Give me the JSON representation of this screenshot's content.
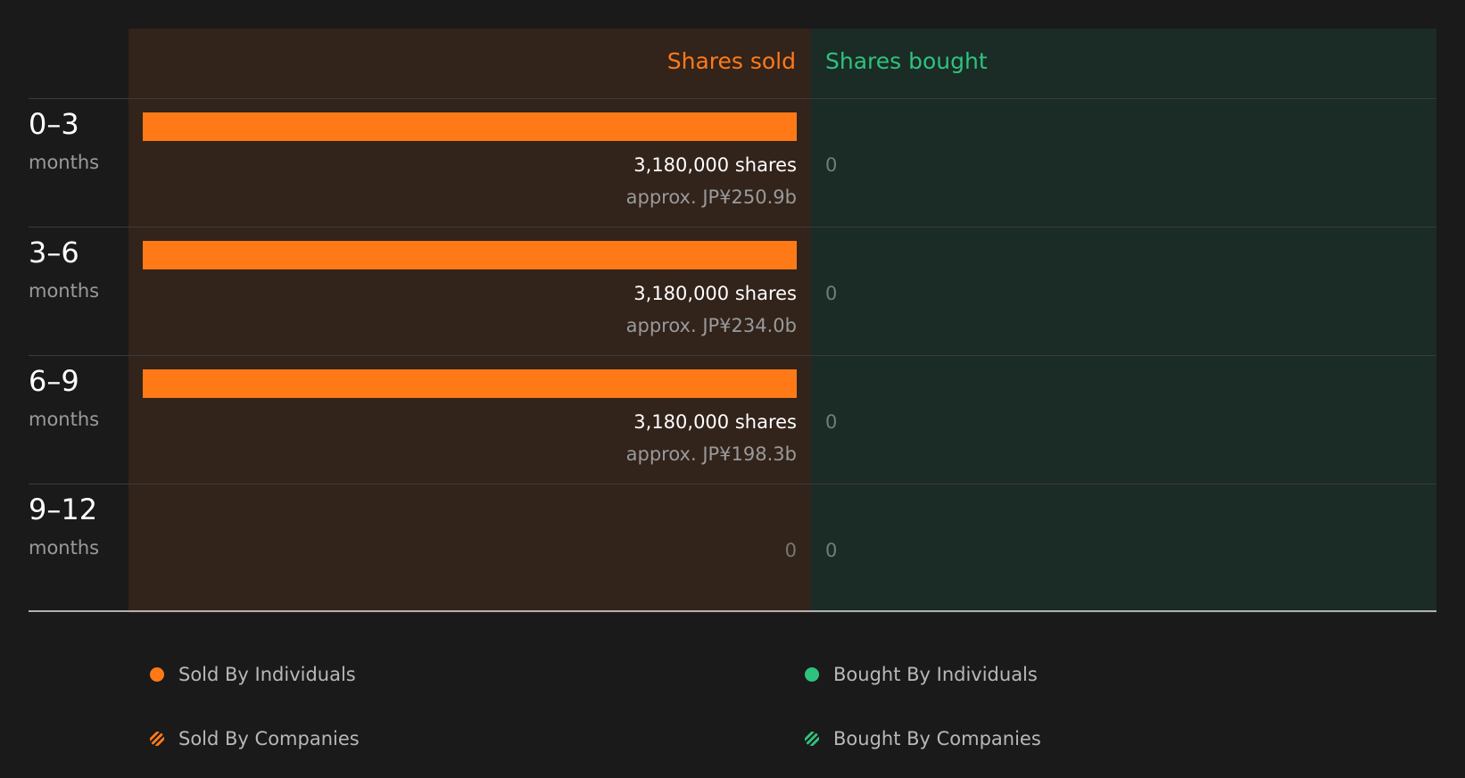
{
  "chart_data": {
    "type": "bar",
    "headers": {
      "sold": "Shares sold",
      "bought": "Shares bought"
    },
    "categories": [
      "0–3",
      "3–6",
      "6–9",
      "9–12"
    ],
    "category_unit": "months",
    "series": [
      {
        "name": "Shares sold",
        "values": [
          3180000,
          3180000,
          3180000,
          0
        ]
      },
      {
        "name": "Shares bought",
        "values": [
          0,
          0,
          0,
          0
        ]
      }
    ],
    "rows": [
      {
        "range": "0–3",
        "unit": "months",
        "sold": 3180000,
        "sold_label": "3,180,000 shares",
        "approx": "approx. JP¥250.9b",
        "bought_label": "0"
      },
      {
        "range": "3–6",
        "unit": "months",
        "sold": 3180000,
        "sold_label": "3,180,000 shares",
        "approx": "approx. JP¥234.0b",
        "bought_label": "0"
      },
      {
        "range": "6–9",
        "unit": "months",
        "sold": 3180000,
        "sold_label": "3,180,000 shares",
        "approx": "approx. JP¥198.3b",
        "bought_label": "0"
      },
      {
        "range": "9–12",
        "unit": "months",
        "sold": 0,
        "sold_label": "0",
        "approx": "",
        "bought_label": "0"
      }
    ],
    "max_value": 3180000,
    "legend": [
      {
        "label": "Sold By Individuals",
        "color": "#ff7a17",
        "style": "solid"
      },
      {
        "label": "Bought By Individuals",
        "color": "#2ec27e",
        "style": "solid"
      },
      {
        "label": "Sold By Companies",
        "color": "#ff7a17",
        "style": "striped"
      },
      {
        "label": "Bought By Companies",
        "color": "#2ec27e",
        "style": "striped"
      }
    ],
    "colors": {
      "sold": "#ff7a17",
      "bought": "#2ec27e",
      "sold_panel": "#32231b",
      "bought_panel": "#1b2b25"
    }
  }
}
